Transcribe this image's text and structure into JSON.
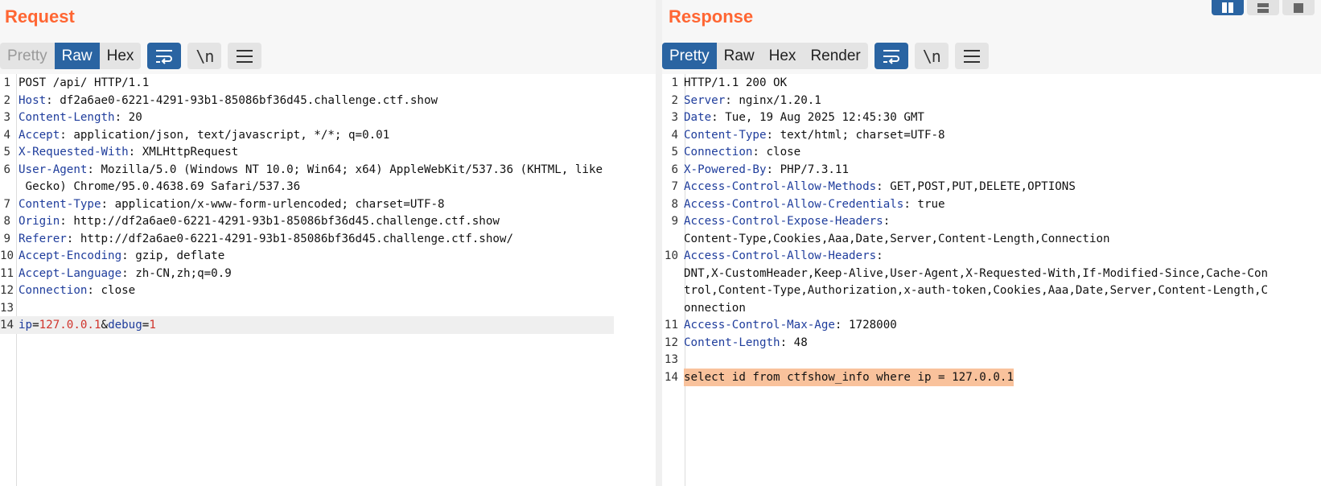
{
  "request": {
    "title": "Request",
    "tabs": [
      "Pretty",
      "Raw",
      "Hex"
    ],
    "active_tab": "Raw",
    "newline_label": "\\n",
    "lines": [
      {
        "n": "1",
        "name": "",
        "value": "POST /api/ HTTP/1.1"
      },
      {
        "n": "2",
        "name": "Host",
        "value": ": df2a6ae0-6221-4291-93b1-85086bf36d45.challenge.ctf.show"
      },
      {
        "n": "3",
        "name": "Content-Length",
        "value": ": 20"
      },
      {
        "n": "4",
        "name": "Accept",
        "value": ": application/json, text/javascript, */*; q=0.01"
      },
      {
        "n": "5",
        "name": "X-Requested-With",
        "value": ": XMLHttpRequest"
      },
      {
        "n": "6",
        "name": "User-Agent",
        "value": ": Mozilla/5.0 (Windows NT 10.0; Win64; x64) AppleWebKit/537.36 (KHTML, like"
      },
      {
        "n": "",
        "name": "",
        "value": " Gecko) Chrome/95.0.4638.69 Safari/537.36"
      },
      {
        "n": "7",
        "name": "Content-Type",
        "value": ": application/x-www-form-urlencoded; charset=UTF-8"
      },
      {
        "n": "8",
        "name": "Origin",
        "value": ": http://df2a6ae0-6221-4291-93b1-85086bf36d45.challenge.ctf.show"
      },
      {
        "n": "9",
        "name": "Referer",
        "value": ": http://df2a6ae0-6221-4291-93b1-85086bf36d45.challenge.ctf.show/"
      },
      {
        "n": "10",
        "name": "Accept-Encoding",
        "value": ": gzip, deflate"
      },
      {
        "n": "11",
        "name": "Accept-Language",
        "value": ": zh-CN,zh;q=0.9"
      },
      {
        "n": "12",
        "name": "Connection",
        "value": ": close"
      },
      {
        "n": "13",
        "name": "",
        "value": ""
      }
    ],
    "body_line": {
      "n": "14",
      "param1_name": "ip",
      "eq1": "=",
      "param1_value": "127.0.0.1",
      "amp": "&",
      "param2_name": "debug",
      "eq2": "=",
      "param2_value": "1"
    }
  },
  "response": {
    "title": "Response",
    "tabs": [
      "Pretty",
      "Raw",
      "Hex",
      "Render"
    ],
    "active_tab": "Pretty",
    "newline_label": "\\n",
    "lines": [
      {
        "n": "1",
        "name": "",
        "value": "HTTP/1.1 200 OK"
      },
      {
        "n": "2",
        "name": "Server",
        "value": ": nginx/1.20.1"
      },
      {
        "n": "3",
        "name": "Date",
        "value": ": Tue, 19 Aug 2025 12:45:30 GMT"
      },
      {
        "n": "4",
        "name": "Content-Type",
        "value": ": text/html; charset=UTF-8"
      },
      {
        "n": "5",
        "name": "Connection",
        "value": ": close"
      },
      {
        "n": "6",
        "name": "X-Powered-By",
        "value": ": PHP/7.3.11"
      },
      {
        "n": "7",
        "name": "Access-Control-Allow-Methods",
        "value": ": GET,POST,PUT,DELETE,OPTIONS"
      },
      {
        "n": "8",
        "name": "Access-Control-Allow-Credentials",
        "value": ": true"
      },
      {
        "n": "9",
        "name": "Access-Control-Expose-Headers",
        "value": ":"
      },
      {
        "n": "",
        "name": "",
        "value": "Content-Type,Cookies,Aaa,Date,Server,Content-Length,Connection"
      },
      {
        "n": "10",
        "name": "Access-Control-Allow-Headers",
        "value": ":"
      },
      {
        "n": "",
        "name": "",
        "value": "DNT,X-CustomHeader,Keep-Alive,User-Agent,X-Requested-With,If-Modified-Since,Cache-Con"
      },
      {
        "n": "",
        "name": "",
        "value": "trol,Content-Type,Authorization,x-auth-token,Cookies,Aaa,Date,Server,Content-Length,C"
      },
      {
        "n": "",
        "name": "",
        "value": "onnection"
      },
      {
        "n": "11",
        "name": "Access-Control-Max-Age",
        "value": ": 1728000"
      },
      {
        "n": "12",
        "name": "Content-Length",
        "value": ": 48"
      },
      {
        "n": "13",
        "name": "",
        "value": ""
      }
    ],
    "body_line": {
      "n": "14",
      "text": "select id from ctfshow_info where ip = 127.0.0.1"
    }
  },
  "colors": {
    "accent": "#2a64a2",
    "title": "#ff6633",
    "header_name": "#1f3d9c",
    "param_value": "#d0342c",
    "highlight": "#f9c29c"
  },
  "icons": [
    "wrap-lines-icon",
    "menu-icon",
    "layout-split-icon",
    "layout-horizontal-icon",
    "layout-single-icon"
  ]
}
